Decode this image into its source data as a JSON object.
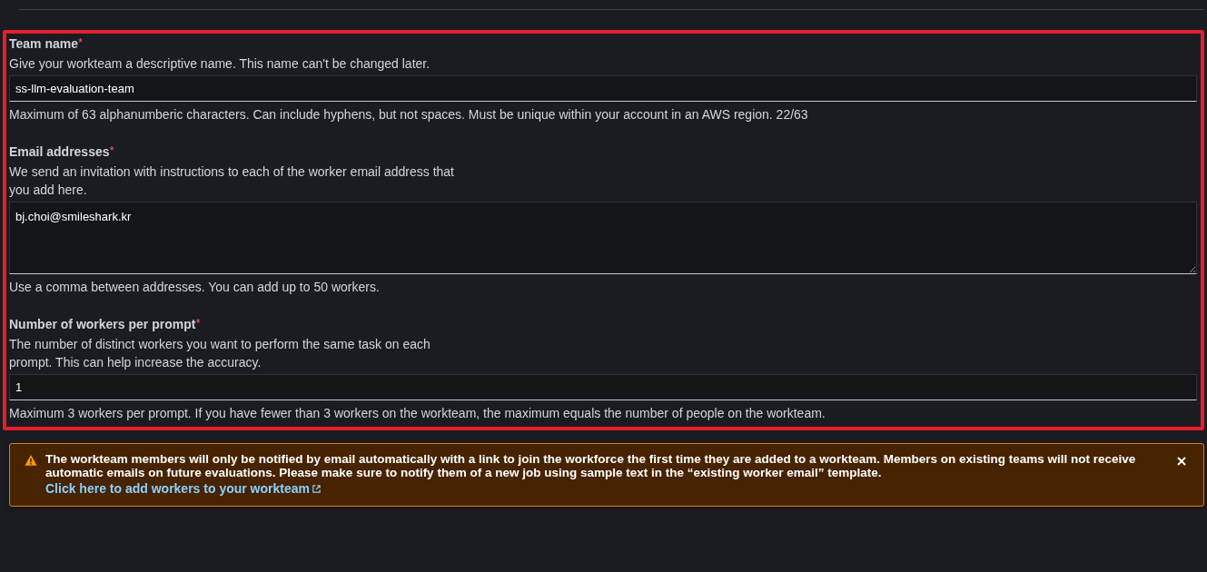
{
  "fields": [
    {
      "kind": "input",
      "label": "Team name",
      "required_mark": "*",
      "description": "Give your workteam a descriptive name. This name can't be changed later.",
      "value": "ss-llm-evaluation-team",
      "hint": "Maximum of 63 alphanumberic characters. Can include hyphens, but not spaces. Must be unique within your account in an AWS region. 22/63"
    },
    {
      "kind": "textarea",
      "label": "Email addresses",
      "required_mark": "*",
      "description": "We send an invitation with instructions to each of the worker email address that you add here.",
      "value": "bj.choi@smileshark.kr",
      "hint": "Use a comma between addresses. You can add up to 50 workers."
    },
    {
      "kind": "input",
      "label": "Number of workers per prompt",
      "required_mark": "*",
      "description": "The number of distinct workers you want to perform the same task on each prompt. This can help increase the accuracy.",
      "value": "1",
      "hint": "Maximum 3 workers per prompt. If you have fewer than 3 workers on the workteam, the maximum equals the number of people on the workteam."
    }
  ],
  "alert": {
    "message": "The workteam members will only be notified by email automatically with a link to join the workforce the first time they are added to a workteam. Members on existing teams will not receive automatic emails on future evaluations. Please make sure to notify them of a new job using sample text in the “existing worker email” template.",
    "link": "Click here to add workers to your workteam",
    "dismissible": true
  }
}
